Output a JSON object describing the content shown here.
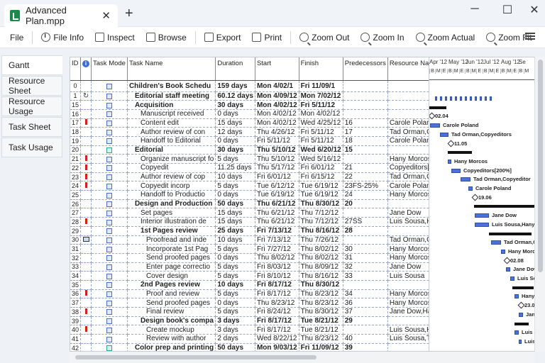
{
  "window": {
    "tab_title": "Advanced Plan.mpp",
    "new_tab": "+",
    "close_tab": "✕",
    "minimize": "─",
    "maximize": "☐",
    "close": "✕"
  },
  "toolbar": {
    "file": "File",
    "file_info": "File Info",
    "inspect": "Inspect",
    "browse": "Browse",
    "export": "Export",
    "print": "Print",
    "zoom_out": "Zoom Out",
    "zoom_in": "Zoom In",
    "zoom_actual": "Zoom Actual",
    "zoom_fit": "Zoom Fit"
  },
  "sidebar": {
    "items": [
      "Gantt",
      "Resource Sheet",
      "Resource Usage",
      "Task Sheet",
      "Task Usage"
    ]
  },
  "grid": {
    "columns": [
      "ID",
      "i",
      "Task Mode",
      "Task Name",
      "Duration",
      "Start",
      "Finish",
      "Predecessors",
      "Resource Names"
    ],
    "rows": [
      {
        "id": "0",
        "ind": "",
        "mode": "a",
        "name": "Children's Book Schedu",
        "dur": "159 days",
        "start": "Mon 4/02/1",
        "finish": "Fri 11/09/1",
        "pred": "",
        "res": "",
        "lvl": 0,
        "sum": true
      },
      {
        "id": "1",
        "ind": "rec",
        "mode": "a",
        "name": "Editorial staff meeting",
        "dur": "60.12 days",
        "start": "Mon 4/09/12",
        "finish": "Mon 7/02/12",
        "pred": "",
        "res": "",
        "lvl": 1,
        "sum": true
      },
      {
        "id": "15",
        "ind": "",
        "mode": "a",
        "name": "Acquisition",
        "dur": "30 days",
        "start": "Mon 4/02/12",
        "finish": "Fri 5/11/12",
        "pred": "",
        "res": "",
        "lvl": 1,
        "sum": true
      },
      {
        "id": "16",
        "ind": "",
        "mode": "a",
        "name": "Manuscript received",
        "dur": "0 days",
        "start": "Mon 4/02/12",
        "finish": "Mon 4/02/12",
        "pred": "",
        "res": "",
        "lvl": 2,
        "sum": false
      },
      {
        "id": "17",
        "ind": "red",
        "mode": "a",
        "name": "Content edit",
        "dur": "15 days",
        "start": "Mon 4/02/12",
        "finish": "Wed 4/25/12",
        "pred": "16",
        "res": "Carole Poland",
        "lvl": 2,
        "sum": false
      },
      {
        "id": "18",
        "ind": "",
        "mode": "a",
        "name": "Author review of con",
        "dur": "12 days",
        "start": "Thu 4/26/12",
        "finish": "Fri 5/11/12",
        "pred": "17",
        "res": "Tad Orman,Copye",
        "lvl": 2,
        "sum": false
      },
      {
        "id": "19",
        "ind": "",
        "mode": "a",
        "name": "Handoff to Editorial",
        "dur": "0 days",
        "start": "Fri 5/11/12",
        "finish": "Fri 5/11/12",
        "pred": "18",
        "res": "Carole Poland",
        "lvl": 2,
        "sum": false
      },
      {
        "id": "20",
        "ind": "",
        "mode": "g",
        "name": "Editorial",
        "dur": "30 days",
        "start": "Thu 5/10/12",
        "finish": "Wed 6/20/12",
        "pred": "15",
        "res": "",
        "lvl": 1,
        "sum": true
      },
      {
        "id": "21",
        "ind": "red",
        "mode": "a",
        "name": "Organize manuscript fo",
        "dur": "5 days",
        "start": "Thu 5/10/12",
        "finish": "Wed 5/16/12",
        "pred": "",
        "res": "Hany Morcos",
        "lvl": 2,
        "sum": false
      },
      {
        "id": "22",
        "ind": "red",
        "mode": "a",
        "name": "Copyedit",
        "dur": "11.25 days",
        "start": "Thu 5/17/12",
        "finish": "Fri 6/01/12",
        "pred": "21",
        "res": "Copyeditors[200%",
        "lvl": 2,
        "sum": false
      },
      {
        "id": "23",
        "ind": "red",
        "mode": "a",
        "name": "Author review of cop",
        "dur": "10 days",
        "start": "Fri 6/01/12",
        "finish": "Fri 6/15/12",
        "pred": "22",
        "res": "Tad Orman,Copye",
        "lvl": 2,
        "sum": false
      },
      {
        "id": "24",
        "ind": "red",
        "mode": "a",
        "name": "Copyedit incorp",
        "dur": "5 days",
        "start": "Tue 6/12/12",
        "finish": "Tue 6/19/12",
        "pred": "23FS-25%",
        "res": "Carole Poland",
        "lvl": 2,
        "sum": false
      },
      {
        "id": "25",
        "ind": "",
        "mode": "a",
        "name": "Handoff to Productio",
        "dur": "0 days",
        "start": "Tue 6/19/12",
        "finish": "Tue 6/19/12",
        "pred": "24",
        "res": "Hany Morcos",
        "lvl": 2,
        "sum": false
      },
      {
        "id": "26",
        "ind": "",
        "mode": "a",
        "name": "Design and Production",
        "dur": "50 days",
        "start": "Thu 6/21/12",
        "finish": "Thu 8/30/12",
        "pred": "20",
        "res": "",
        "lvl": 1,
        "sum": true
      },
      {
        "id": "27",
        "ind": "",
        "mode": "a",
        "name": "Set pages",
        "dur": "15 days",
        "start": "Thu 6/21/12",
        "finish": "Thu 7/12/12",
        "pred": "",
        "res": "Jane Dow",
        "lvl": 2,
        "sum": false
      },
      {
        "id": "28",
        "ind": "red",
        "mode": "a",
        "name": "Interior illustration de",
        "dur": "15 days",
        "start": "Thu 6/21/12",
        "finish": "Thu 7/12/12",
        "pred": "27SS",
        "res": "Luis Sousa,Hany M",
        "lvl": 2,
        "sum": false
      },
      {
        "id": "29",
        "ind": "",
        "mode": "a",
        "name": "1st Pages review",
        "dur": "25 days",
        "start": "Fri 7/13/12",
        "finish": "Thu 8/16/12",
        "pred": "28",
        "res": "",
        "lvl": 2,
        "sum": true
      },
      {
        "id": "30",
        "ind": "cal",
        "mode": "a",
        "name": "Proofread and inde",
        "dur": "10 days",
        "start": "Fri 7/13/12",
        "finish": "Thu 7/26/12",
        "pred": "",
        "res": "Tad Orman,Copye",
        "lvl": 3,
        "sum": false
      },
      {
        "id": "31",
        "ind": "",
        "mode": "a",
        "name": "Incorporate 1st Pag",
        "dur": "5 days",
        "start": "Fri 7/27/12",
        "finish": "Thu 8/02/12",
        "pred": "30",
        "res": "Hany Morcos",
        "lvl": 3,
        "sum": false
      },
      {
        "id": "32",
        "ind": "",
        "mode": "a",
        "name": "Send proofed pages",
        "dur": "0 days",
        "start": "Thu 8/02/12",
        "finish": "Thu 8/02/12",
        "pred": "31",
        "res": "Hany Morcos",
        "lvl": 3,
        "sum": false
      },
      {
        "id": "33",
        "ind": "",
        "mode": "a",
        "name": "Enter page correctio",
        "dur": "5 days",
        "start": "Fri 8/03/12",
        "finish": "Thu 8/09/12",
        "pred": "32",
        "res": "Jane Dow",
        "lvl": 3,
        "sum": false
      },
      {
        "id": "34",
        "ind": "",
        "mode": "a",
        "name": "Cover design",
        "dur": "5 days",
        "start": "Fri 8/10/12",
        "finish": "Thu 8/16/12",
        "pred": "33",
        "res": "Luis Sousa",
        "lvl": 3,
        "sum": false
      },
      {
        "id": "35",
        "ind": "",
        "mode": "a",
        "name": "2nd Pages review",
        "dur": "10 days",
        "start": "Fri 8/17/12",
        "finish": "Thu 8/30/12",
        "pred": "",
        "res": "",
        "lvl": 2,
        "sum": true
      },
      {
        "id": "36",
        "ind": "red",
        "mode": "a",
        "name": "Proof and review",
        "dur": "5 days",
        "start": "Fri 8/17/12",
        "finish": "Thu 8/23/12",
        "pred": "34",
        "res": "Hany Morcos",
        "lvl": 3,
        "sum": false
      },
      {
        "id": "37",
        "ind": "",
        "mode": "a",
        "name": "Send proofed pages",
        "dur": "0 days",
        "start": "Thu 8/23/12",
        "finish": "Thu 8/23/12",
        "pred": "36",
        "res": "Hany Morcos",
        "lvl": 3,
        "sum": false
      },
      {
        "id": "38",
        "ind": "red",
        "mode": "a",
        "name": "Final review",
        "dur": "5 days",
        "start": "Fri 8/24/12",
        "finish": "Thu 8/30/12",
        "pred": "37",
        "res": "Jane Dow,Hany M",
        "lvl": 3,
        "sum": false
      },
      {
        "id": "39",
        "ind": "",
        "mode": "a",
        "name": "Design book's compa",
        "dur": "3 days",
        "start": "Fri 8/17/12",
        "finish": "Tue 8/21/12",
        "pred": "29",
        "res": "",
        "lvl": 2,
        "sum": true
      },
      {
        "id": "40",
        "ind": "red",
        "mode": "a",
        "name": "Create mockup",
        "dur": "3 days",
        "start": "Fri 8/17/12",
        "finish": "Tue 8/21/12",
        "pred": "",
        "res": "Luis Sousa,Hany M",
        "lvl": 3,
        "sum": false
      },
      {
        "id": "41",
        "ind": "",
        "mode": "a",
        "name": "Review with author",
        "dur": "2 days",
        "start": "Wed 8/22/12",
        "finish": "Thu 8/23/12",
        "pred": "40",
        "res": "Luis Sousa,Tad O",
        "lvl": 3,
        "sum": false
      },
      {
        "id": "42",
        "ind": "",
        "mode": "g",
        "name": "Color prep and printing",
        "dur": "50 days",
        "start": "Mon 9/03/12",
        "finish": "Fri 11/09/12",
        "pred": "39",
        "res": "",
        "lvl": 1,
        "sum": true
      }
    ]
  },
  "gantt": {
    "months": [
      "Apr '12",
      "May '12",
      "Jun '12",
      "Jul '12",
      "Aug '12",
      "Se"
    ],
    "ticks": [
      "B",
      "M",
      "E",
      "B",
      "M",
      "E",
      "B",
      "M",
      "E",
      "B",
      "M",
      "E",
      "B",
      "M",
      "E",
      "B",
      "M"
    ],
    "labels": {
      "m16": "02.04",
      "r17": "Carole Poland",
      "r18": "Tad Orman,Copyeditors",
      "m19": "11.05",
      "r21": "Hany Morcos",
      "r22": "Copyeditors[200%]",
      "r23": "Tad Orman,Copyeditor",
      "r24": "Carole Poland",
      "m25": "19.06",
      "r27": "Jane Dow",
      "r28": "Luis Sousa,Hany Morc",
      "r30": "Tad Orman,Copy",
      "r31": "Hany Morcos",
      "m32": "02.08",
      "r33": "Jane Dow",
      "r34": "Luis Sousa",
      "r36": "Hany",
      "m37": "23.0",
      "r38": "Jane",
      "r40": "Luis S",
      "r41": "Luis S"
    }
  }
}
